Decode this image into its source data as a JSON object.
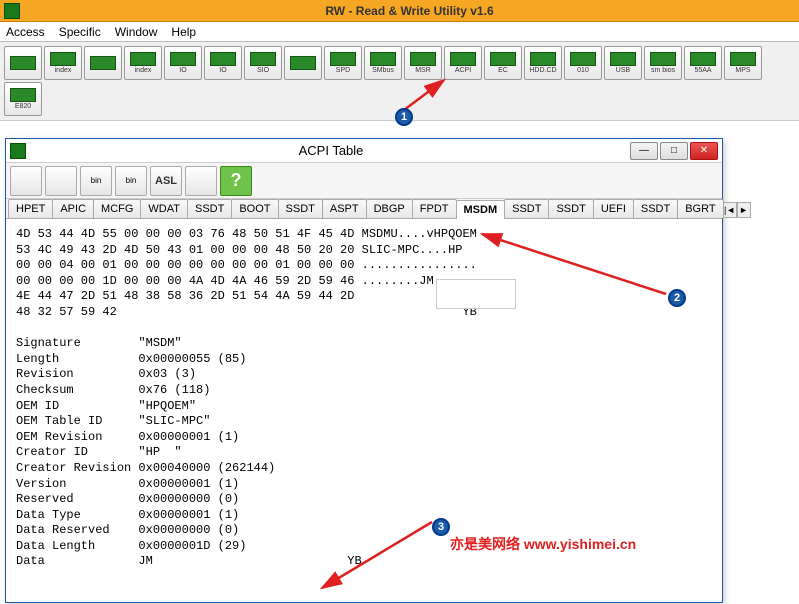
{
  "window": {
    "title": "RW - Read & Write Utility v1.6"
  },
  "menu": {
    "items": [
      "Access",
      "Specific",
      "Window",
      "Help"
    ]
  },
  "toolbar_buttons": [
    {
      "label": "",
      "name": "mem-icon"
    },
    {
      "label": "index",
      "name": "index-icon"
    },
    {
      "label": "",
      "name": "chip-icon"
    },
    {
      "label": "index",
      "name": "index2-icon"
    },
    {
      "label": "IO",
      "name": "io-icon"
    },
    {
      "label": "IO",
      "name": "io2-icon"
    },
    {
      "label": "SIO",
      "name": "sio-icon"
    },
    {
      "label": "",
      "name": "wave-icon"
    },
    {
      "label": "SPD",
      "name": "spd-icon"
    },
    {
      "label": "SMbus",
      "name": "smbus-icon"
    },
    {
      "label": "MSR",
      "name": "msr-icon"
    },
    {
      "label": "ACPI",
      "name": "acpi-icon"
    },
    {
      "label": "EC",
      "name": "ec-icon"
    },
    {
      "label": "HDD.CD",
      "name": "hdd-icon"
    },
    {
      "label": "010",
      "name": "010-icon"
    },
    {
      "label": "USB",
      "name": "usb-icon"
    },
    {
      "label": "sm bios",
      "name": "smbios-icon"
    },
    {
      "label": "55AA",
      "name": "55aa-icon"
    },
    {
      "label": "MPS",
      "name": "mps-icon"
    },
    {
      "label": "E820",
      "name": "e820-icon"
    }
  ],
  "acpi": {
    "title": "ACPI Table",
    "toolbar": [
      {
        "name": "save-icon",
        "label": ""
      },
      {
        "name": "save-multi-icon",
        "label": ""
      },
      {
        "name": "bin-icon",
        "label": "bin"
      },
      {
        "name": "bin-multi-icon",
        "label": "bin"
      },
      {
        "name": "asl-icon",
        "label": "ASL"
      },
      {
        "name": "find-icon",
        "label": ""
      },
      {
        "name": "help-icon",
        "label": "?"
      }
    ],
    "tabs": [
      "HPET",
      "APIC",
      "MCFG",
      "WDAT",
      "SSDT",
      "BOOT",
      "SSDT",
      "ASPT",
      "DBGP",
      "FPDT",
      "MSDM",
      "SSDT",
      "SSDT",
      "UEFI",
      "SSDT",
      "BGRT"
    ],
    "active_tab": "MSDM",
    "hex_rows": [
      "4D 53 44 4D 55 00 00 00 03 76 48 50 51 4F 45 4D MSDMU....vHPQOEM",
      "53 4C 49 43 2D 4D 50 43 01 00 00 00 48 50 20 20 SLIC-MPC....HP  ",
      "00 00 04 00 01 00 00 00 00 00 00 00 01 00 00 00 ................",
      "00 00 00 00 1D 00 00 00 4A 4D 4A 46 59 2D 59 46 ........JM",
      "4E 44 47 2D 51 48 38 58 36 2D 51 54 4A 59 44 2D",
      "48 32 57 59 42                                                YB"
    ],
    "fields": [
      {
        "k": "Signature",
        "v": "\"MSDM\""
      },
      {
        "k": "Length",
        "v": "0x00000055 (85)"
      },
      {
        "k": "Revision",
        "v": "0x03 (3)"
      },
      {
        "k": "Checksum",
        "v": "0x76 (118)"
      },
      {
        "k": "OEM ID",
        "v": "\"HPQOEM\""
      },
      {
        "k": "OEM Table ID",
        "v": "\"SLIC-MPC\""
      },
      {
        "k": "OEM Revision",
        "v": "0x00000001 (1)"
      },
      {
        "k": "Creator ID",
        "v": "\"HP  \""
      },
      {
        "k": "Creator Revision",
        "v": "0x00040000 (262144)"
      },
      {
        "k": "Version",
        "v": "0x00000001 (1)"
      },
      {
        "k": "Reserved",
        "v": "0x00000000 (0)"
      },
      {
        "k": "Data Type",
        "v": "0x00000001 (1)"
      },
      {
        "k": "Data Reserved",
        "v": "0x00000000 (0)"
      },
      {
        "k": "Data Length",
        "v": "0x0000001D (29)"
      },
      {
        "k": "Data",
        "v": "JM                           YB"
      }
    ]
  },
  "annotations": {
    "a1": "1",
    "a2": "2",
    "a3": "3"
  },
  "watermark": "亦是美网络 www.yishimei.cn"
}
